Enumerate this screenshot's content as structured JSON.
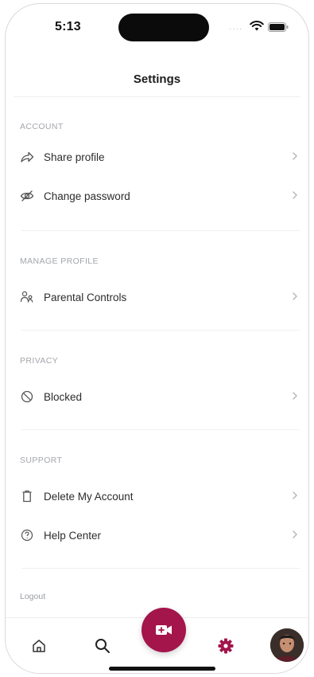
{
  "status_bar": {
    "time": "5:13",
    "signal": "····"
  },
  "header": {
    "title": "Settings"
  },
  "sections": [
    {
      "header": "ACCOUNT",
      "items": [
        {
          "label": "Share profile",
          "icon": "share-icon"
        },
        {
          "label": "Change password",
          "icon": "eye-off-icon"
        }
      ]
    },
    {
      "header": "MANAGE PROFILE",
      "items": [
        {
          "label": "Parental Controls",
          "icon": "parental-controls-icon"
        }
      ]
    },
    {
      "header": "PRIVACY",
      "items": [
        {
          "label": "Blocked",
          "icon": "block-icon"
        }
      ]
    },
    {
      "header": "SUPPORT",
      "items": [
        {
          "label": "Delete My Account",
          "icon": "trash-icon"
        },
        {
          "label": "Help Center",
          "icon": "help-icon"
        }
      ]
    }
  ],
  "logout": {
    "label": "Logout"
  },
  "tab_bar": {
    "items": [
      {
        "name": "home",
        "icon": "home-icon",
        "active": false
      },
      {
        "name": "search",
        "icon": "search-icon",
        "active": false
      },
      {
        "name": "record",
        "icon": "video-camera-icon",
        "active": false
      },
      {
        "name": "settings",
        "icon": "gear-icon",
        "active": true
      },
      {
        "name": "profile",
        "icon": "avatar",
        "active": false
      }
    ]
  },
  "colors": {
    "accent": "#a3154b",
    "section_header": "#a3a6ab",
    "label": "#2c2c2e",
    "chevron": "#b3b5b9"
  }
}
